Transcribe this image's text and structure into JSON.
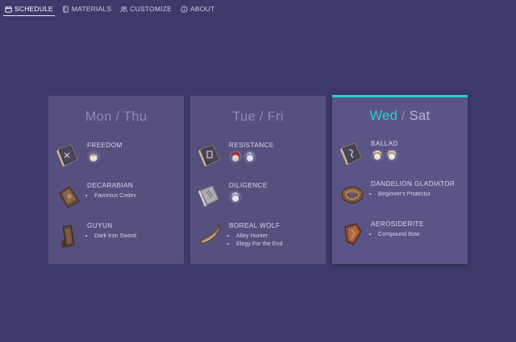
{
  "nav": {
    "items": [
      {
        "label": "SCHEDULE",
        "icon": "calendar-icon",
        "active": true
      },
      {
        "label": "MATERIALS",
        "icon": "book-icon",
        "active": false
      },
      {
        "label": "CUSTOMIZE",
        "icon": "users-icon",
        "active": false
      },
      {
        "label": "ABOUT",
        "icon": "info-icon",
        "active": false
      }
    ]
  },
  "colors": {
    "background": "#3d3a6b",
    "card": "#56507f",
    "accent": "#22d4cf"
  },
  "days": [
    {
      "title_a": "Mon",
      "sep": " / ",
      "title_b": "Thu",
      "highlight": false,
      "items": [
        {
          "name": "FREEDOM",
          "icon": "talent-book-icon",
          "characters": [
            "character-avatar-icon"
          ],
          "list": []
        },
        {
          "name": "DECARABIAN",
          "icon": "weapon-material-icon",
          "characters": [],
          "list": [
            "Favonius Codex"
          ]
        },
        {
          "name": "GUYUN",
          "icon": "weapon-material-icon",
          "characters": [],
          "list": [
            "Dark Iron Sword"
          ]
        }
      ]
    },
    {
      "title_a": "Tue",
      "sep": " / ",
      "title_b": "Fri",
      "highlight": false,
      "items": [
        {
          "name": "RESISTANCE",
          "icon": "talent-book-icon",
          "characters": [
            "character-avatar-icon",
            "character-avatar-icon"
          ],
          "list": []
        },
        {
          "name": "DILIGENCE",
          "icon": "talent-book-icon",
          "characters": [
            "character-avatar-icon"
          ],
          "list": []
        },
        {
          "name": "BOREAL WOLF",
          "icon": "weapon-material-icon",
          "characters": [],
          "list": [
            "Alley Hunter",
            "Elegy For the End"
          ]
        }
      ]
    },
    {
      "title_a": "Wed",
      "sep": " / ",
      "title_b": "Sat",
      "highlight": true,
      "items": [
        {
          "name": "BALLAD",
          "icon": "talent-book-icon",
          "characters": [
            "character-avatar-icon",
            "character-avatar-icon"
          ],
          "list": []
        },
        {
          "name": "DANDELION GLADIATOR",
          "icon": "weapon-material-icon",
          "characters": [],
          "list": [
            "Beginner's Protector"
          ]
        },
        {
          "name": "AEROSIDERITE",
          "icon": "weapon-material-icon",
          "characters": [],
          "list": [
            "Compound Bow"
          ]
        }
      ]
    }
  ]
}
